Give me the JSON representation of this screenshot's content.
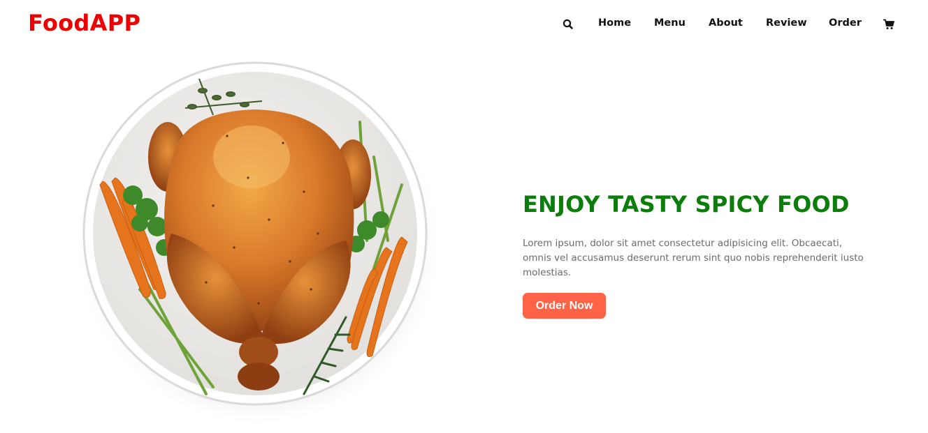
{
  "header": {
    "logo": "FoodAPP",
    "search_icon": "search-icon",
    "cart_icon": "cart-icon",
    "nav": [
      "Home",
      "Menu",
      "About",
      "Review",
      "Order"
    ]
  },
  "hero": {
    "image": "roast-chicken-plate-image",
    "title": "ENJOY TASTY SPICY FOOD",
    "text": "Lorem ipsum, dolor sit amet consectetur adipisicing elit. Obcaecati, omnis vel accusamus deserunt rerum sint quo nobis reprehenderit iusto molestias.",
    "button_label": "Order Now"
  },
  "colors": {
    "logo": "#ee0000",
    "title": "#0a7d0a",
    "button": "#ff6347",
    "body_text": "#6b6b6b"
  }
}
